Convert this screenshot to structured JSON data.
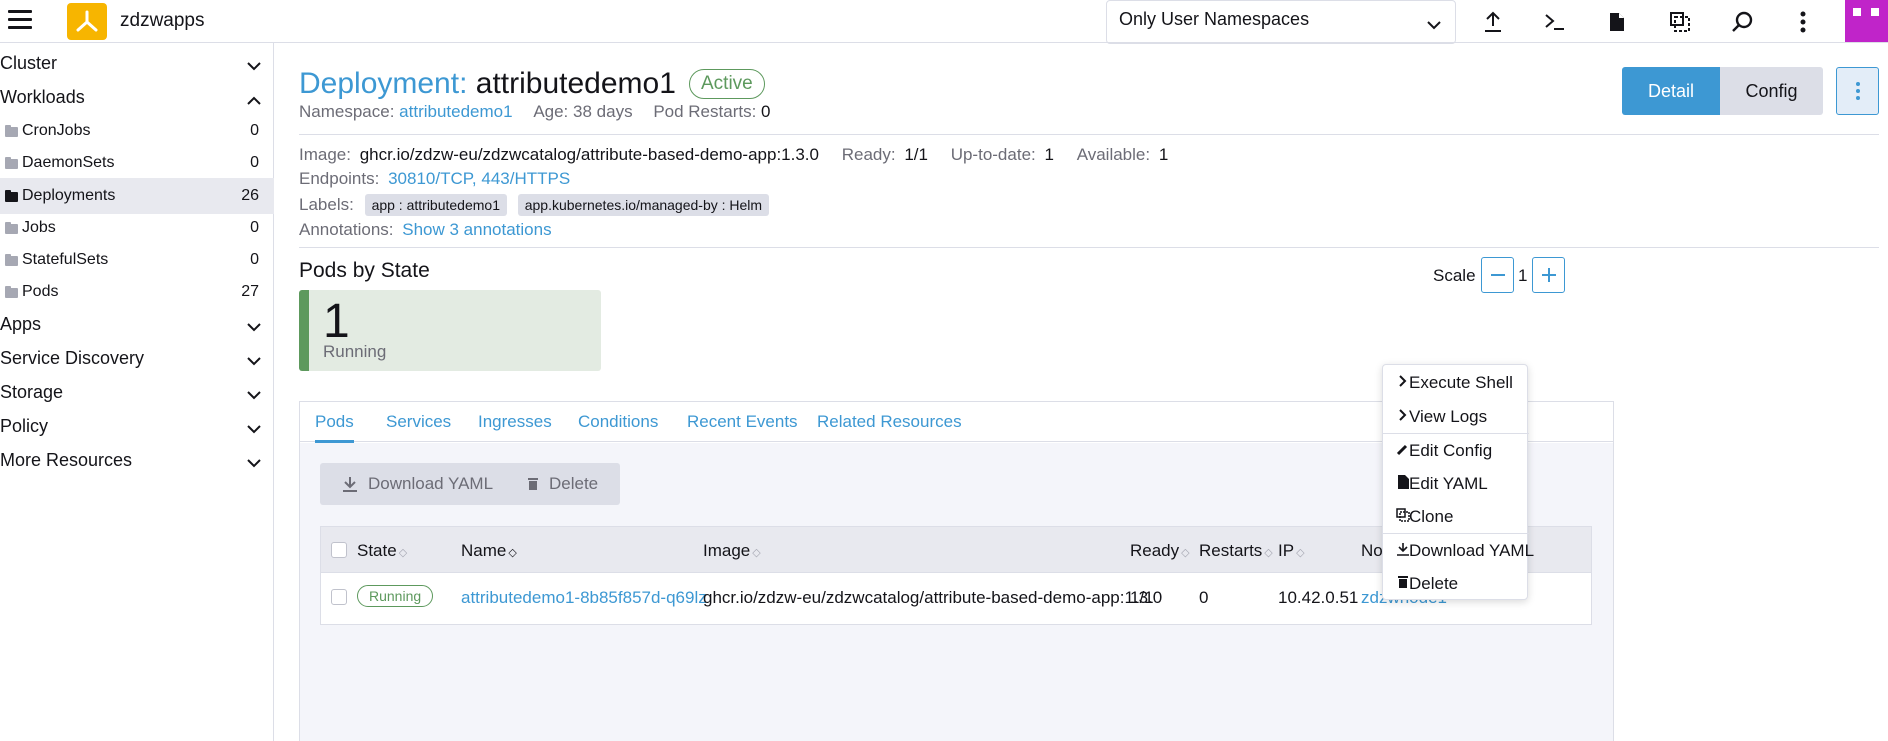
{
  "header": {
    "cluster_name": "zdzwapps",
    "namespace_filter": "Only User Namespaces"
  },
  "sidebar": {
    "groups": {
      "cluster": "Cluster",
      "workloads": "Workloads",
      "apps": "Apps",
      "service_discovery": "Service Discovery",
      "storage": "Storage",
      "policy": "Policy",
      "more_resources": "More Resources"
    },
    "items": [
      {
        "label": "CronJobs",
        "count": "0"
      },
      {
        "label": "DaemonSets",
        "count": "0"
      },
      {
        "label": "Deployments",
        "count": "26"
      },
      {
        "label": "Jobs",
        "count": "0"
      },
      {
        "label": "StatefulSets",
        "count": "0"
      },
      {
        "label": "Pods",
        "count": "27"
      }
    ]
  },
  "resource": {
    "kind": "Deployment:",
    "name": "attributedemo1",
    "state": "Active",
    "namespace_label": "Namespace:",
    "namespace": "attributedemo1",
    "age_label": "Age:",
    "age": "38 days",
    "restarts_label": "Pod Restarts:",
    "restarts": "0"
  },
  "view_toggle": {
    "detail": "Detail",
    "config": "Config"
  },
  "details": {
    "image_label": "Image:",
    "image": "ghcr.io/zdzw-eu/zdzwcatalog/attribute-based-demo-app:1.3.0",
    "ready_label": "Ready:",
    "ready": "1/1",
    "uptodate_label": "Up-to-date:",
    "uptodate": "1",
    "available_label": "Available:",
    "available": "1",
    "endpoints_label": "Endpoints:",
    "endpoint1": "30810/TCP",
    "endpoint_sep": ",",
    "endpoint2": "443/HTTPS",
    "labels_label": "Labels:",
    "label1": "app : attributedemo1",
    "label2": "app.kubernetes.io/managed-by : Helm",
    "annotations_label": "Annotations:",
    "annotations_link": "Show 3 annotations"
  },
  "pods_state": {
    "title": "Pods by State",
    "scale_label": "Scale",
    "scale_value": "1",
    "count": "1",
    "state": "Running"
  },
  "tabs": [
    "Pods",
    "Services",
    "Ingresses",
    "Conditions",
    "Recent Events",
    "Related Resources"
  ],
  "actions": {
    "download_yaml": "Download YAML",
    "delete": "Delete"
  },
  "table": {
    "headers": {
      "state": "State",
      "name": "Name",
      "image": "Image",
      "ready": "Ready",
      "restarts": "Restarts",
      "ip": "IP",
      "node": "Node"
    },
    "rows": [
      {
        "state": "Running",
        "name": "attributedemo1-8b85f857d-q69lz",
        "image": "ghcr.io/zdzw-eu/zdzwcatalog/attribute-based-demo-app:1.3.0",
        "ready": "1/1",
        "restarts": "0",
        "ip": "10.42.0.51",
        "node": "zdzwnode1"
      }
    ]
  },
  "context_menu": {
    "execute_shell": "Execute Shell",
    "view_logs": "View Logs",
    "edit_config": "Edit Config",
    "edit_yaml": "Edit YAML",
    "clone": "Clone",
    "download_yaml": "Download YAML",
    "delete": "Delete"
  }
}
